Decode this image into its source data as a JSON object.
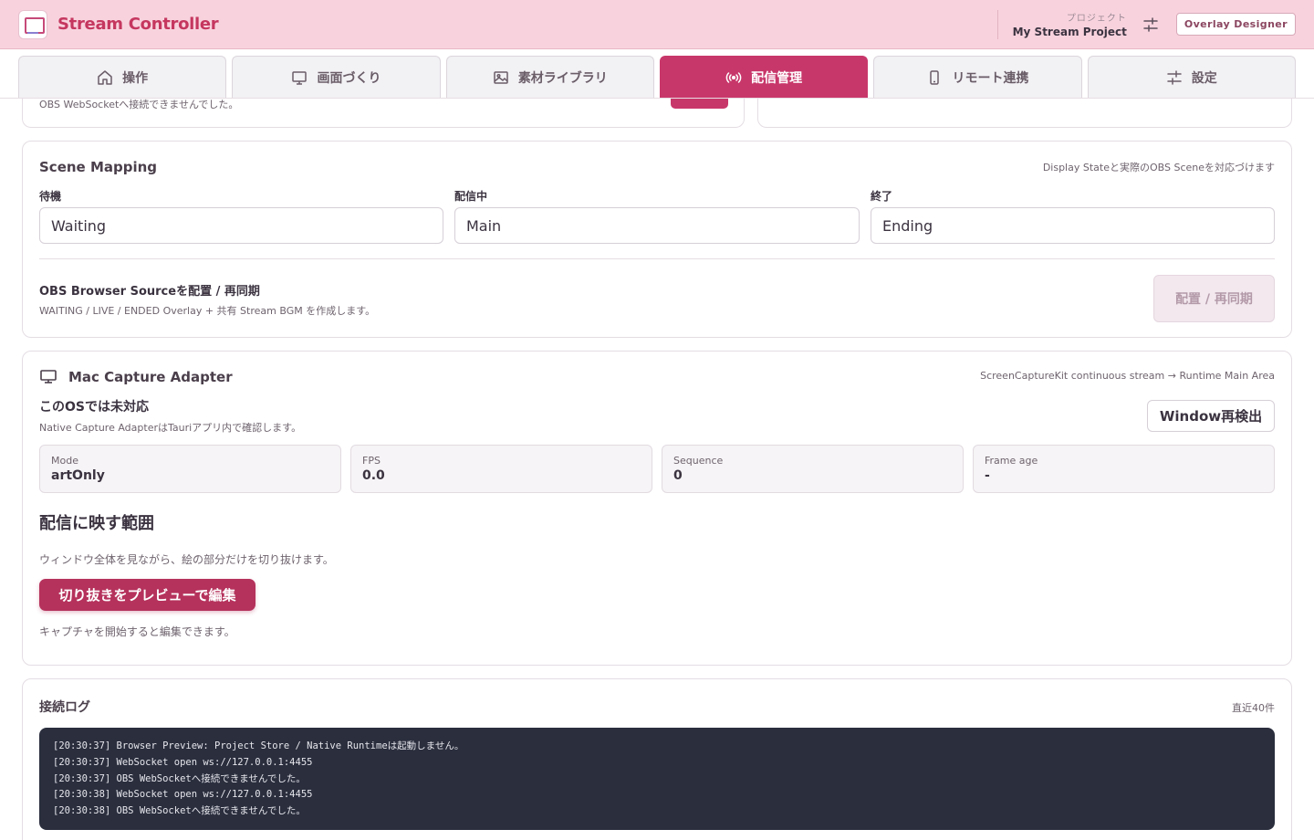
{
  "app": {
    "title": "Stream Controller"
  },
  "header": {
    "project_kicker": "プロジェクト",
    "project_name": "My Stream Project",
    "settings_icon": "sliders-icon",
    "designer_button": "Overlay Designer"
  },
  "tabs": [
    {
      "label": "操作",
      "icon": "home-icon",
      "active": false
    },
    {
      "label": "画面づくり",
      "icon": "monitor-icon",
      "active": false
    },
    {
      "label": "素材ライブラリ",
      "icon": "image-icon",
      "active": false
    },
    {
      "label": "配信管理",
      "icon": "broadcast-icon",
      "active": true
    },
    {
      "label": "リモート連携",
      "icon": "smartphone-icon",
      "active": false
    },
    {
      "label": "設定",
      "icon": "sliders-icon",
      "active": false
    }
  ],
  "obs_card": {
    "status_text": "OBS WebSocketへ接続できませんでした。"
  },
  "scene_mapping": {
    "title": "Scene Mapping",
    "note": "Display Stateと実際のOBS Sceneを対応づけます",
    "fields": [
      {
        "label": "待機",
        "value": "Waiting"
      },
      {
        "label": "配信中",
        "value": "Main"
      },
      {
        "label": "終了",
        "value": "Ending"
      }
    ],
    "source_title": "OBS Browser Sourceを配置 / 再同期",
    "source_desc": "WAITING / LIVE / ENDED Overlay + 共有 Stream BGM を作成します。",
    "sync_button": "配置 / 再同期"
  },
  "capture": {
    "title": "Mac Capture Adapter",
    "note": "ScreenCaptureKit continuous stream → Runtime Main Area",
    "unsupported_title": "このOSでは未対応",
    "unsupported_desc": "Native Capture AdapterはTauriアプリ内で確認します。",
    "redetect_button": "Window再検出",
    "stats": [
      {
        "label": "Mode",
        "value": "artOnly"
      },
      {
        "label": "FPS",
        "value": "0.0"
      },
      {
        "label": "Sequence",
        "value": "0"
      },
      {
        "label": "Frame age",
        "value": "-"
      }
    ],
    "range_heading": "配信に映す範囲",
    "range_desc": "ウィンドウ全体を見ながら、絵の部分だけを切り抜けます。",
    "crop_button": "切り抜きをプレビューで編集",
    "crop_hint": "キャプチャを開始すると編集できます。"
  },
  "log": {
    "title": "接続ログ",
    "note": "直近40件",
    "lines": [
      "[20:30:37] Browser Preview: Project Store / Native Runtimeは起動しません。",
      "[20:30:37] WebSocket open ws://127.0.0.1:4455",
      "[20:30:37] OBS WebSocketへ接続できませんでした。",
      "[20:30:38] WebSocket open ws://127.0.0.1:4455",
      "[20:30:38] OBS WebSocketへ接続できませんでした。"
    ]
  },
  "colors": {
    "accent": "#c8376a",
    "header_bg": "#f8d3de",
    "log_bg": "#2a2e3d"
  }
}
